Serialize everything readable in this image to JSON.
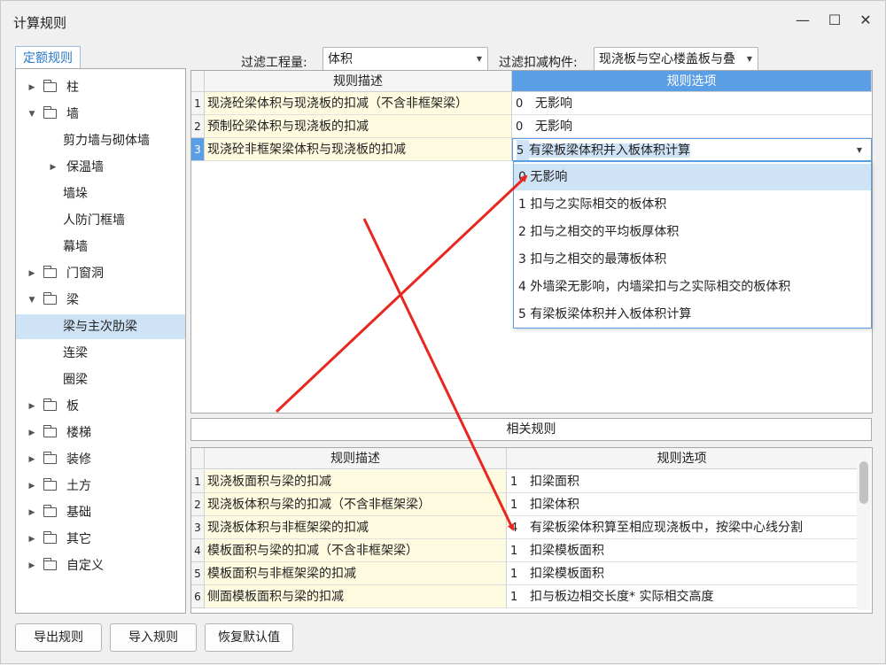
{
  "window": {
    "title": "计算规则"
  },
  "tab": {
    "label": "定额规则"
  },
  "tree": {
    "items": [
      {
        "label": "柱",
        "arrow": "▶"
      },
      {
        "label": "墙",
        "arrow": "▼"
      },
      {
        "label": "剪力墙与砌体墙",
        "arrow": ""
      },
      {
        "label": "保温墙",
        "arrow": "▶"
      },
      {
        "label": "墙垛",
        "arrow": ""
      },
      {
        "label": "人防门框墙",
        "arrow": ""
      },
      {
        "label": "幕墙",
        "arrow": ""
      },
      {
        "label": "门窗洞",
        "arrow": "▶"
      },
      {
        "label": "梁",
        "arrow": "▼"
      },
      {
        "label": "梁与主次肋梁",
        "arrow": ""
      },
      {
        "label": "连梁",
        "arrow": ""
      },
      {
        "label": "圈梁",
        "arrow": ""
      },
      {
        "label": "板",
        "arrow": "▶"
      },
      {
        "label": "楼梯",
        "arrow": "▶"
      },
      {
        "label": "装修",
        "arrow": "▶"
      },
      {
        "label": "土方",
        "arrow": "▶"
      },
      {
        "label": "基础",
        "arrow": "▶"
      },
      {
        "label": "其它",
        "arrow": "▶"
      },
      {
        "label": "自定义",
        "arrow": "▶"
      }
    ]
  },
  "filter": {
    "quantity_label": "过滤工程量:",
    "quantity_value": "体积",
    "component_label": "过滤扣减构件:",
    "component_value": "现浇板与空心楼盖板与叠"
  },
  "rules_grid": {
    "headers": [
      "规则描述",
      "规则选项"
    ],
    "rows": [
      {
        "num": "1",
        "desc": "现浇砼梁体积与现浇板的扣减（不含非框架梁）",
        "opt_num": "0",
        "opt": "无影响"
      },
      {
        "num": "2",
        "desc": "预制砼梁体积与现浇板的扣减",
        "opt_num": "0",
        "opt": "无影响"
      },
      {
        "num": "3",
        "desc": "现浇砼非框架梁体积与现浇板的扣减",
        "opt_num": "5",
        "opt": "有梁板梁体积并入板体积计算"
      }
    ]
  },
  "dropdown": {
    "options": [
      "0  无影响",
      "1 扣与之实际相交的板体积",
      "2 扣与之相交的平均板厚体积",
      "3 扣与之相交的最薄板体积",
      "4 外墙梁无影响，内墙梁扣与之实际相交的板体积",
      "5 有梁板梁体积并入板体积计算"
    ]
  },
  "related": {
    "title": "相关规则",
    "headers": [
      "规则描述",
      "规则选项"
    ],
    "rows": [
      {
        "num": "1",
        "desc": "现浇板面积与梁的扣减",
        "opt_num": "1",
        "opt": "扣梁面积"
      },
      {
        "num": "2",
        "desc": "现浇板体积与梁的扣减（不含非框架梁）",
        "opt_num": "1",
        "opt": "扣梁体积"
      },
      {
        "num": "3",
        "desc": "现浇板体积与非框架梁的扣减",
        "opt_num": "4",
        "opt": "有梁板梁体积算至相应现浇板中，按梁中心线分割"
      },
      {
        "num": "4",
        "desc": "模板面积与梁的扣减（不含非框架梁）",
        "opt_num": "1",
        "opt": "扣梁模板面积"
      },
      {
        "num": "5",
        "desc": "模板面积与非框架梁的扣减",
        "opt_num": "1",
        "opt": "扣梁模板面积"
      },
      {
        "num": "6",
        "desc": "侧面模板面积与梁的扣减",
        "opt_num": "1",
        "opt": "扣与板边相交长度* 实际相交高度"
      }
    ]
  },
  "buttons": {
    "export": "导出规则",
    "import": "导入规则",
    "restore": "恢复默认值"
  },
  "colors": {
    "accent": "#5a9fe6",
    "desc_bg": "#fffbe0",
    "arrow": "#e8271e"
  }
}
